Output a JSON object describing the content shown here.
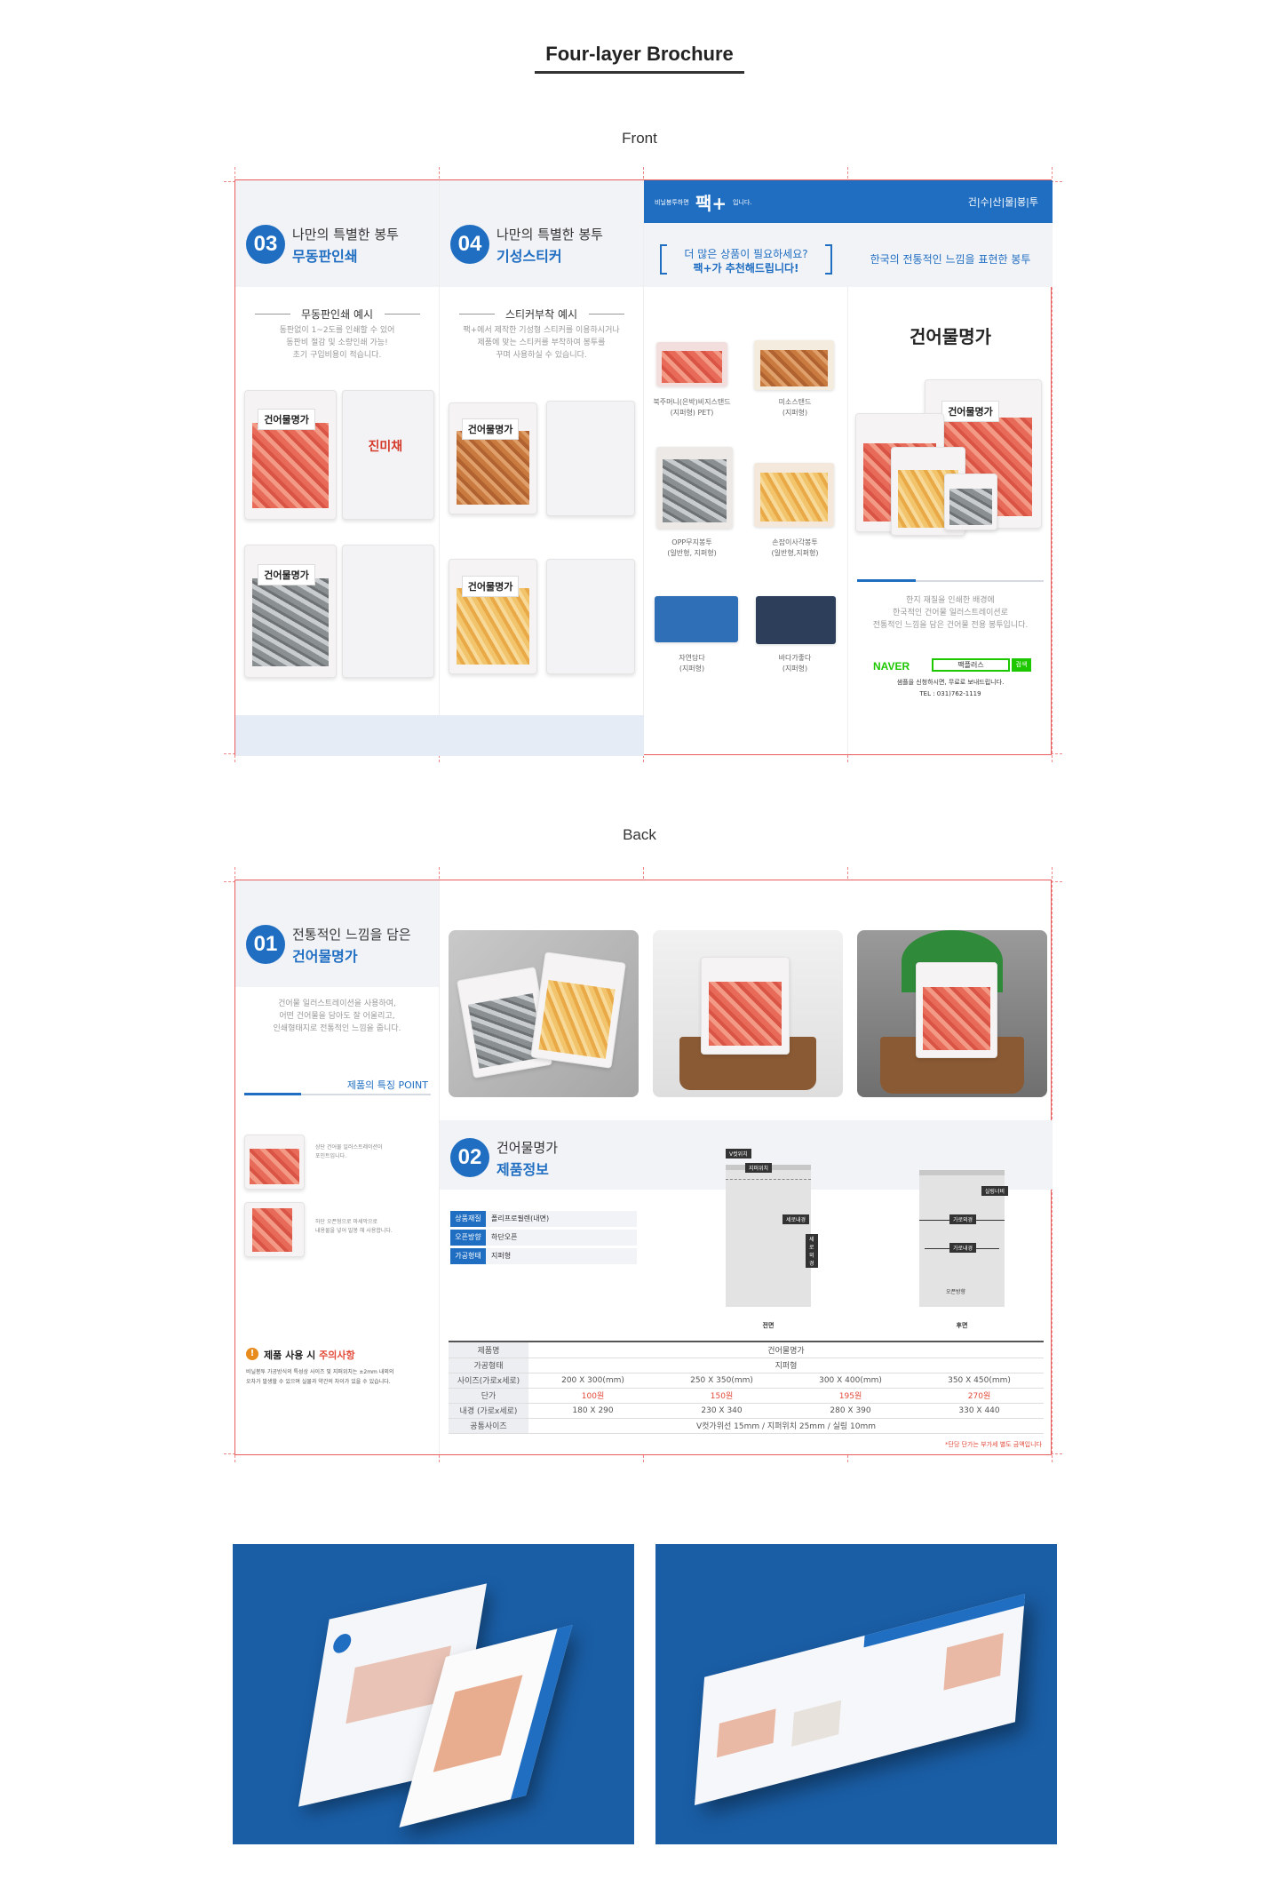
{
  "title": "Four-layer Brochure",
  "front": {
    "label": "Front",
    "panel1": {
      "number": "03",
      "line1": "나만의 특별한 봉투",
      "line2": "무동판인쇄",
      "sub": "무동판인쇄 예시",
      "desc": [
        "동판없이 1~2도를 인쇄할 수 있어",
        "동판비 절감 및 소량인쇄 가능!",
        "초기 구입비용이 적습니다."
      ],
      "bag1_label": "건어물명가",
      "bag2_label": "진미채",
      "bag3_label": "건어물명가"
    },
    "panel2": {
      "number": "04",
      "line1": "나만의 특별한 봉투",
      "line2": "기성스티커",
      "sub": "스티커부착 예시",
      "desc": [
        "팩+에서 제작한 기성형 스티커를 이용하시거나",
        "제품에 맞는 스티커를 부착하여 봉투를",
        "꾸며 사용하실 수 있습니다."
      ],
      "bag1_label": "건어물명가",
      "bag2_label": "건어물명가"
    },
    "panel3": {
      "bar_small": "비닐봉투하면",
      "bar_logo": "팩+",
      "bar_small2": "입니다.",
      "bracket1": "더 많은 상품이 필요하세요?",
      "bracket2": "팩+가 추천해드립니다!",
      "items": [
        [
          "북주머니(은박)비지스탠드",
          "(지퍼형) PET)"
        ],
        [
          "미소스탠드",
          "(지퍼형)"
        ],
        [
          "OPP무지봉투",
          "(일반형, 지퍼형)"
        ],
        [
          "손잡이사각봉투",
          "(일반형,지퍼형)"
        ],
        [
          "자연담다",
          "(지퍼형)"
        ],
        [
          "바다가좋다",
          "(지퍼형)"
        ]
      ]
    },
    "panel4": {
      "bar_text": "건|수|산|물|봉|투",
      "headline": "한국의 전통적인 느낌을 표현한 봉투",
      "product_name": "건어물명가",
      "bag_label": "건어물명가",
      "desc": [
        "한지 재질을 인쇄한 배경에",
        "한국적인 건어물 일러스트레이션로",
        "전통적인 느낌을 담은 건어물 전용 봉투입니다."
      ],
      "naver": "NAVER",
      "search_text": "팩플러스",
      "search_btn": "검색",
      "sample": "샘플을 신청하시면, 무료로 보내드립니다.",
      "tel": "TEL : 031)762-1119"
    }
  },
  "back": {
    "label": "Back",
    "panel1": {
      "number": "01",
      "line1": "전통적인 느낌을 담은",
      "line2": "건어물명가",
      "desc": [
        "건어물 일러스트레이션을 사용하여,",
        "어떤 건어물을 담아도 잘 어울리고,",
        "인쇄형태지로 전통적인 느낌을 줍니다."
      ],
      "point_title": "제품의 특징 POINT",
      "point1": [
        "상단 건어물 일러스트레이션이",
        "포인트입니다."
      ],
      "point2": [
        "하단 오픈형으로 마세막으로",
        "내용물을 넣어 밀봉 해 사용합니다."
      ],
      "notice_title": "제품 사용 시 ",
      "notice_title_red": "주의사항",
      "notice": [
        "비닐봉투 가공방식의 특성상 사이즈 및 지퍼위치는 ±2mm 내외의",
        "오차가 발생할 수 있으며 실물과 약간의 차이가 있을 수 있습니다."
      ]
    },
    "panel2": {
      "number": "02",
      "line1": "건어물명가",
      "line2": "제품정보",
      "specs": [
        {
          "label": "상품재질",
          "value": "폴리프로필렌(내면)"
        },
        {
          "label": "오픈방향",
          "value": "하단오픈"
        },
        {
          "label": "가공형태",
          "value": "지퍼형"
        }
      ]
    },
    "diagram": {
      "front_caption": "전면",
      "back_caption": "후면",
      "tags_front": [
        "V컷위치",
        "지퍼위치",
        "세로내경",
        "세로외경"
      ],
      "tags_back": [
        "실링너비",
        "가로외경",
        "가로내경",
        "오픈방향"
      ]
    },
    "table": {
      "rows": [
        [
          "제품명",
          "건어물명가"
        ],
        [
          "가공형태",
          "지퍼형"
        ],
        [
          "사이즈(가로x세로)",
          "200 X 300(mm)",
          "250 X 350(mm)",
          "300 X 400(mm)",
          "350 X 450(mm)"
        ],
        [
          "단가",
          "100원",
          "150원",
          "195원",
          "270원"
        ],
        [
          "내경 (가로x세로)",
          "180 X 290",
          "230 X 340",
          "280 X 390",
          "330 X 440"
        ],
        [
          "공통사이즈",
          "V컷가위선 15mm / 지퍼위치 25mm / 실링 10mm"
        ]
      ],
      "footnote": "*단당 단가는 부가세 별도 금액입니다"
    }
  },
  "colors": {
    "accent": "#1f6ec2",
    "guide": "#e85c5c",
    "mockup_bg": "#1a5ea6",
    "highlight": "#e34a3a"
  }
}
